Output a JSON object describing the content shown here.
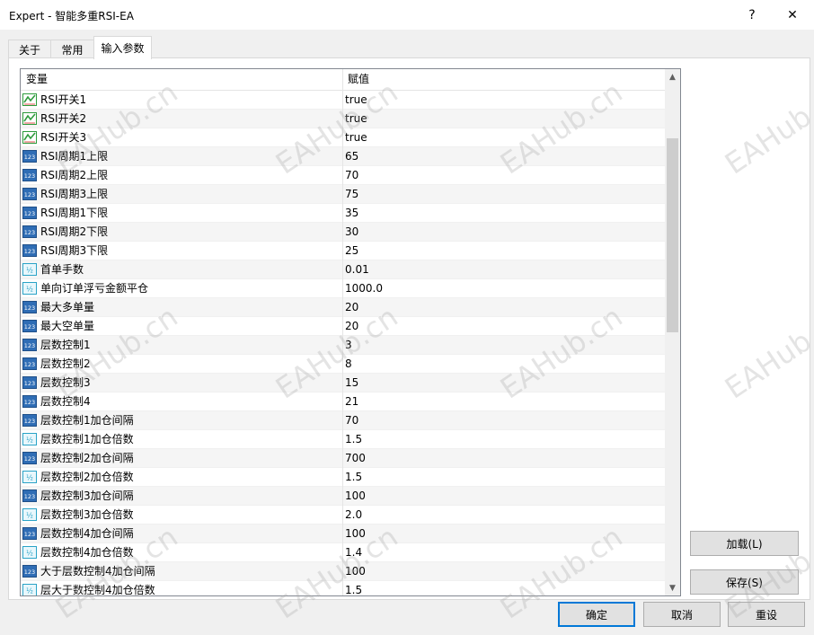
{
  "window": {
    "title": "Expert - 智能多重RSI-EA",
    "help_label": "?",
    "close_label": "✕"
  },
  "tabs": [
    {
      "label": "关于"
    },
    {
      "label": "常用"
    },
    {
      "label": "输入参数",
      "active": true
    }
  ],
  "grid": {
    "headers": {
      "variable": "变量",
      "value": "赋值"
    },
    "rows": [
      {
        "name": "RSI开关1",
        "value": "true",
        "icon": "bool-icon"
      },
      {
        "name": "RSI开关2",
        "value": "true",
        "icon": "bool-icon"
      },
      {
        "name": "RSI开关3",
        "value": "true",
        "icon": "bool-icon"
      },
      {
        "name": "RSI周期1上限",
        "value": "65",
        "icon": "integer-icon"
      },
      {
        "name": "RSI周期2上限",
        "value": "70",
        "icon": "integer-icon"
      },
      {
        "name": "RSI周期3上限",
        "value": "75",
        "icon": "integer-icon"
      },
      {
        "name": "RSI周期1下限",
        "value": "35",
        "icon": "integer-icon"
      },
      {
        "name": "RSI周期2下限",
        "value": "30",
        "icon": "integer-icon"
      },
      {
        "name": "RSI周期3下限",
        "value": "25",
        "icon": "integer-icon"
      },
      {
        "name": "首单手数",
        "value": "0.01",
        "icon": "double-icon"
      },
      {
        "name": "单向订单浮亏金额平仓",
        "value": "1000.0",
        "icon": "double-icon"
      },
      {
        "name": "最大多单量",
        "value": "20",
        "icon": "integer-icon"
      },
      {
        "name": "最大空单量",
        "value": "20",
        "icon": "integer-icon"
      },
      {
        "name": "层数控制1",
        "value": "3",
        "icon": "integer-icon"
      },
      {
        "name": "层数控制2",
        "value": "8",
        "icon": "integer-icon"
      },
      {
        "name": "层数控制3",
        "value": "15",
        "icon": "integer-icon"
      },
      {
        "name": "层数控制4",
        "value": "21",
        "icon": "integer-icon"
      },
      {
        "name": "层数控制1加仓间隔",
        "value": "70",
        "icon": "integer-icon"
      },
      {
        "name": "层数控制1加仓倍数",
        "value": "1.5",
        "icon": "double-icon"
      },
      {
        "name": "层数控制2加仓间隔",
        "value": "700",
        "icon": "integer-icon"
      },
      {
        "name": "层数控制2加仓倍数",
        "value": "1.5",
        "icon": "double-icon"
      },
      {
        "name": "层数控制3加仓间隔",
        "value": "100",
        "icon": "integer-icon"
      },
      {
        "name": "层数控制3加仓倍数",
        "value": "2.0",
        "icon": "double-icon"
      },
      {
        "name": "层数控制4加仓间隔",
        "value": "100",
        "icon": "integer-icon"
      },
      {
        "name": "层数控制4加仓倍数",
        "value": "1.4",
        "icon": "double-icon"
      },
      {
        "name": "大于层数控制4加仓间隔",
        "value": "100",
        "icon": "integer-icon"
      },
      {
        "name": "层大于数控制4加仓倍数",
        "value": "1.5",
        "icon": "double-icon"
      }
    ]
  },
  "side_buttons": {
    "load": "加载(L)",
    "save": "保存(S)"
  },
  "bottom_buttons": {
    "ok": "确定",
    "cancel": "取消",
    "reset": "重设"
  },
  "watermark": "EAHub.cn",
  "icon_labels": {
    "integer": "123",
    "double": "½"
  },
  "colors": {
    "accent": "#0078d7",
    "icon_bool": "#2e9b3d",
    "icon_int": "#2f6db5",
    "icon_double": "#2aa3c7"
  }
}
